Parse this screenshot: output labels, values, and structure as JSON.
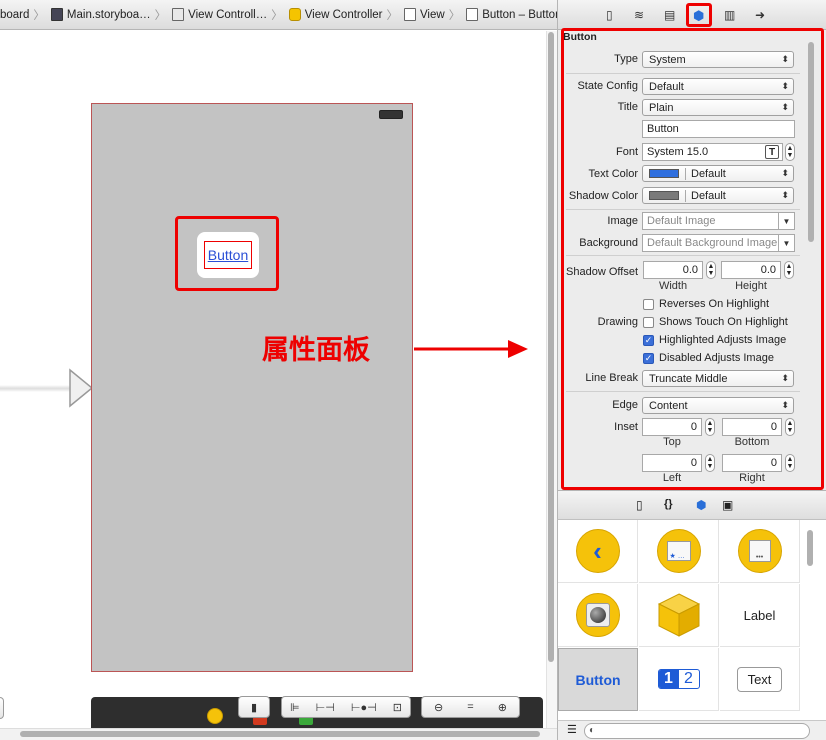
{
  "jumpbar": {
    "crumbs": [
      {
        "label": "board"
      },
      {
        "label": "Main.storyboa…"
      },
      {
        "label": "View Controll…"
      },
      {
        "label": "View Controller"
      },
      {
        "label": "View"
      },
      {
        "label": "Button – Button"
      }
    ]
  },
  "canvas": {
    "button_label": "Button",
    "annotation": "属性面板"
  },
  "inspector": {
    "section_title": "Button",
    "type_label": "Type",
    "type_value": "System",
    "state_label": "State Config",
    "state_value": "Default",
    "title_label": "Title",
    "title_value": "Plain",
    "title_text": "Button",
    "font_label": "Font",
    "font_value": "System 15.0",
    "text_color_label": "Text Color",
    "text_color_value": "Default",
    "text_color_swatch": "#2f6fde",
    "shadow_color_label": "Shadow Color",
    "shadow_color_value": "Default",
    "shadow_color_swatch": "#7a7a7a",
    "image_label": "Image",
    "image_placeholder": "Default Image",
    "background_label": "Background",
    "background_placeholder": "Default Background Image",
    "shadow_offset_label": "Shadow Offset",
    "shadow_width": "0.0",
    "shadow_height": "0.0",
    "width_label": "Width",
    "height_label": "Height",
    "reverses_label": "Reverses On Highlight",
    "drawing_label": "Drawing",
    "shows_touch_label": "Shows Touch On Highlight",
    "highlighted_adjusts_label": "Highlighted Adjusts Image",
    "disabled_adjusts_label": "Disabled Adjusts Image",
    "line_break_label": "Line Break",
    "line_break_value": "Truncate Middle",
    "edge_label": "Edge",
    "edge_value": "Content",
    "inset_label": "Inset",
    "inset_top": "0",
    "inset_bottom": "0",
    "inset_left": "0",
    "inset_right": "0",
    "top_label": "Top",
    "bottom_label": "Bottom",
    "left_label": "Left",
    "right_label": "Right"
  },
  "library": {
    "label_item": "Label",
    "button_item": "Button",
    "seg_1": "1",
    "seg_2": "2",
    "text_item": "Text"
  },
  "colors": {
    "accent_red": "#e00000",
    "library_yellow": "#f5c20a",
    "button_blue": "#2a4fd6"
  }
}
